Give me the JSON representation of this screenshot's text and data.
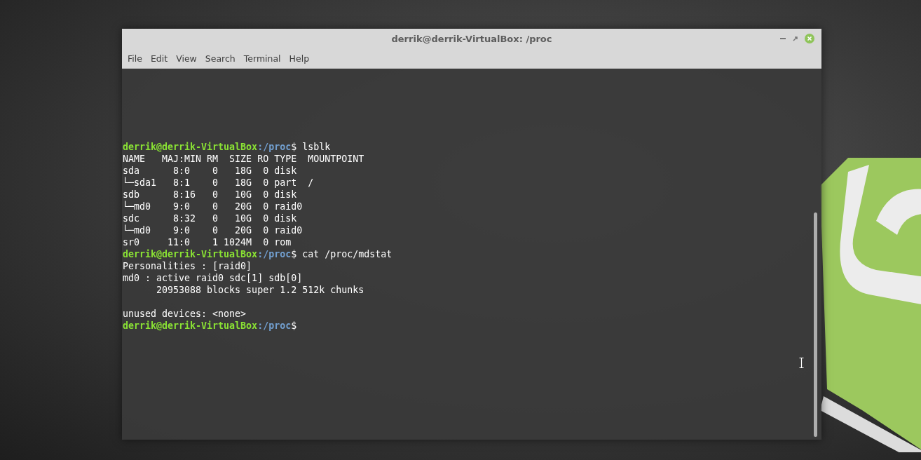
{
  "window": {
    "title": "derrik@derrik-VirtualBox: /proc"
  },
  "menu": [
    "File",
    "Edit",
    "View",
    "Search",
    "Terminal",
    "Help"
  ],
  "terminal": {
    "lines": [
      {
        "kind": "prompt",
        "user_host": "derrik@derrik-VirtualBox",
        "path": ":/proc",
        "command": "$ lsblk"
      },
      {
        "kind": "output",
        "text": "NAME   MAJ:MIN RM  SIZE RO TYPE  MOUNTPOINT"
      },
      {
        "kind": "output",
        "text": "sda      8:0    0   18G  0 disk"
      },
      {
        "kind": "output",
        "text": "└─sda1   8:1    0   18G  0 part  /"
      },
      {
        "kind": "output",
        "text": "sdb      8:16   0   10G  0 disk"
      },
      {
        "kind": "output",
        "text": "└─md0    9:0    0   20G  0 raid0"
      },
      {
        "kind": "output",
        "text": "sdc      8:32   0   10G  0 disk"
      },
      {
        "kind": "output",
        "text": "└─md0    9:0    0   20G  0 raid0"
      },
      {
        "kind": "output",
        "text": "sr0     11:0    1 1024M  0 rom"
      },
      {
        "kind": "prompt",
        "user_host": "derrik@derrik-VirtualBox",
        "path": ":/proc",
        "command": "$ cat /proc/mdstat"
      },
      {
        "kind": "output",
        "text": "Personalities : [raid0]"
      },
      {
        "kind": "output",
        "text": "md0 : active raid0 sdc[1] sdb[0]"
      },
      {
        "kind": "output",
        "text": "      20953088 blocks super 1.2 512k chunks"
      },
      {
        "kind": "blank"
      },
      {
        "kind": "output",
        "text": "unused devices: <none>"
      },
      {
        "kind": "prompt",
        "user_host": "derrik@derrik-VirtualBox",
        "path": ":/proc",
        "command": "$"
      }
    ]
  }
}
